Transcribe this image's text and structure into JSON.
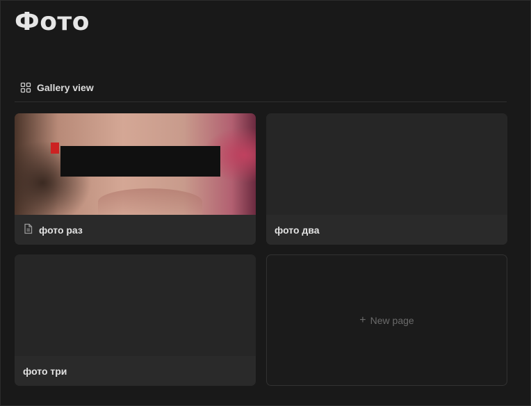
{
  "page": {
    "title": "Фото"
  },
  "view": {
    "label": "Gallery view",
    "icon": "gallery-grid-icon"
  },
  "cards": [
    {
      "title": "фото раз",
      "has_cover": true,
      "icon": "document-icon"
    },
    {
      "title": "фото два",
      "has_cover": false
    },
    {
      "title": "фото три",
      "has_cover": false
    }
  ],
  "new_page": {
    "label": "New page",
    "icon": "plus-icon"
  },
  "colors": {
    "background": "#191919",
    "card": "#252525",
    "text": "#e2e2e2",
    "muted": "#6b6b6b"
  }
}
